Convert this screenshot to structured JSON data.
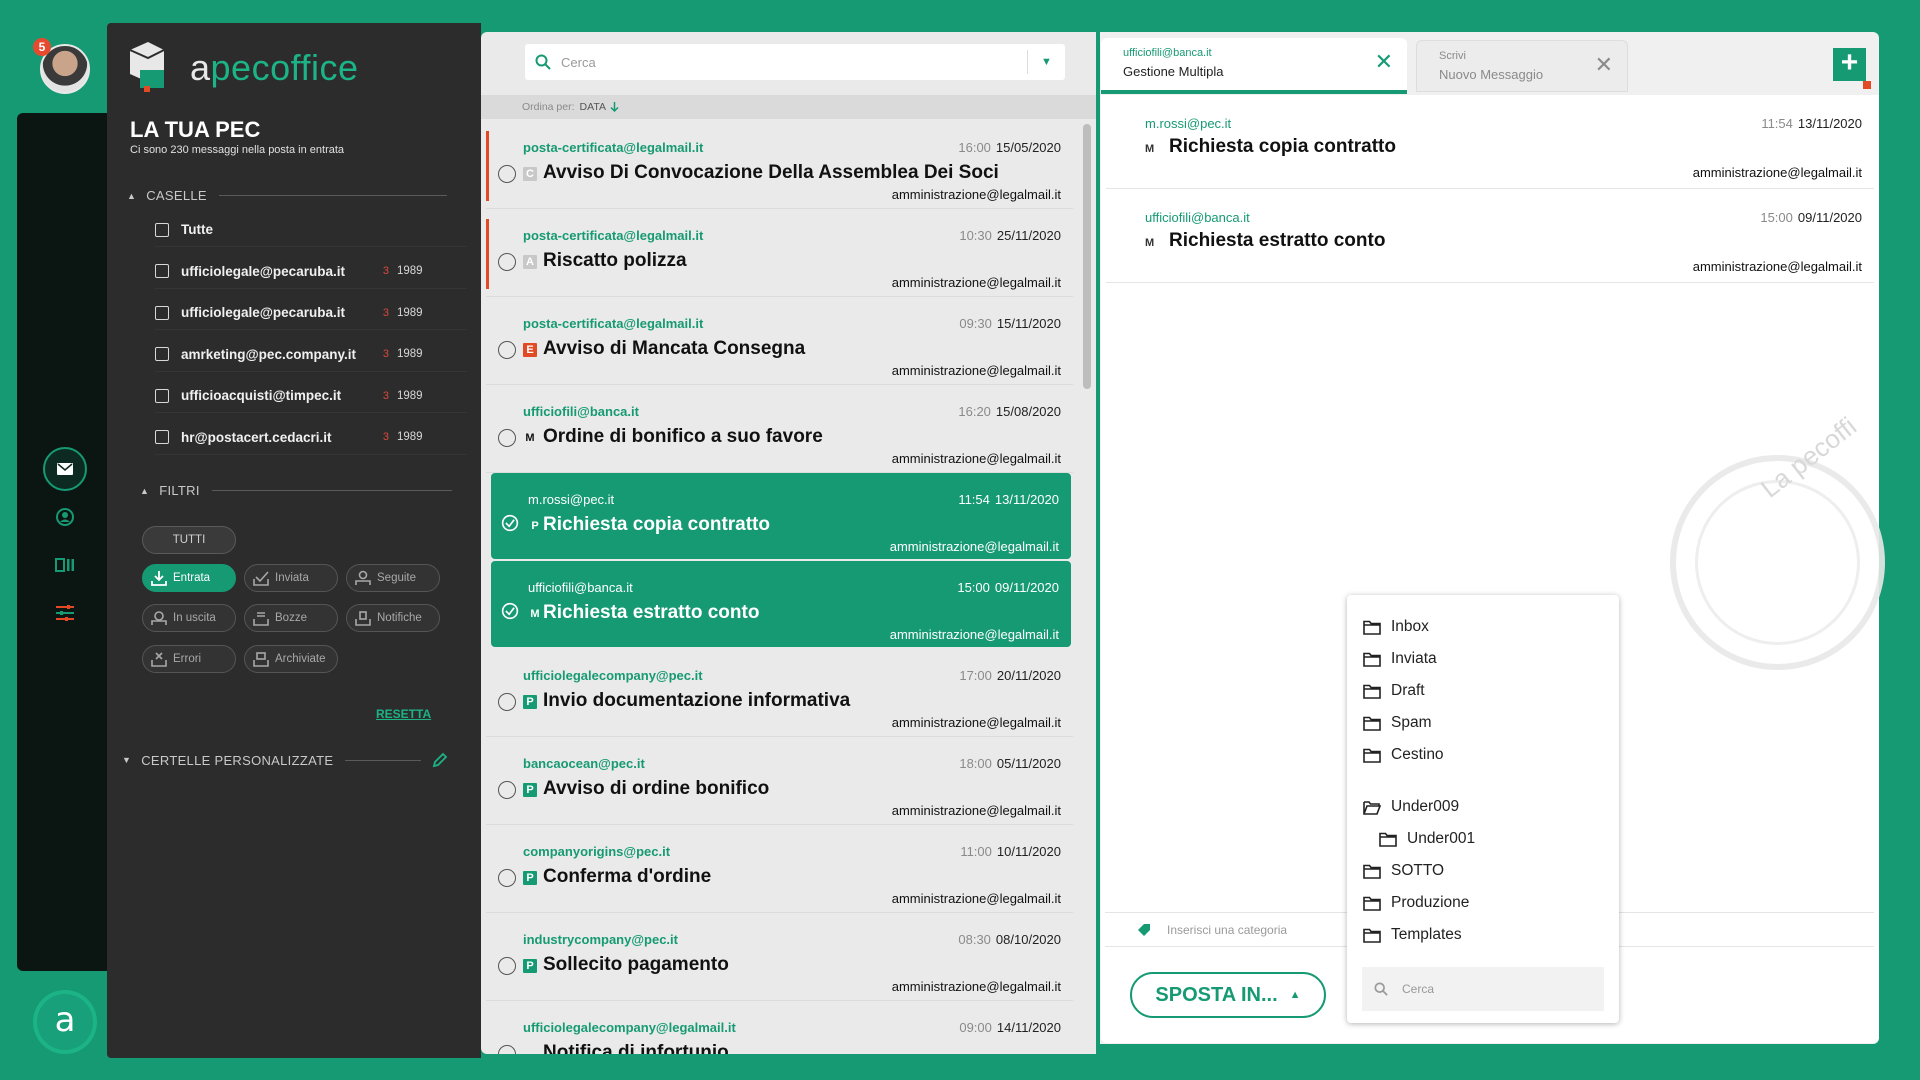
{
  "rail": {
    "avatar_badge": "5",
    "brand_glyph": "a",
    "accent": "#169a73",
    "icons": [
      "mail-icon",
      "user-icon",
      "cards-icon",
      "sliders-icon"
    ]
  },
  "sidebar": {
    "logo_a": "a",
    "logo_pec": "pecoffice",
    "title": "LA TUA PEC",
    "subtitle": "Ci sono 230 messaggi nella posta in entrata",
    "caselle_header": "CASELLE",
    "boxes": [
      {
        "label": "Tutte",
        "count": "",
        "total": ""
      },
      {
        "label": "ufficiolegale@pecaruba.it",
        "count": "3",
        "total": "1989"
      },
      {
        "label": "ufficiolegale@pecaruba.it",
        "count": "3",
        "total": "1989"
      },
      {
        "label": "amrketing@pec.company.it",
        "count": "3",
        "total": "1989"
      },
      {
        "label": "ufficioacquisti@timpec.it",
        "count": "3",
        "total": "1989"
      },
      {
        "label": "hr@postacert.cedacri.it",
        "count": "3",
        "total": "1989"
      }
    ],
    "filtri_header": "FILTRI",
    "filters": {
      "all": "TUTTI",
      "entrata": "Entrata",
      "inviata": "Inviata",
      "seguite": "Seguite",
      "in_uscita": "In uscita",
      "bozze": "Bozze",
      "notifiche": "Notifiche",
      "errori": "Errori",
      "archiviate": "Archiviate"
    },
    "reset": "RESETTA",
    "custom_header": "CERTELLE PERSONALIZZATE"
  },
  "list": {
    "search_placeholder": "Cerca",
    "sort_label": "Ordina per:",
    "sort_value": "DATA",
    "messages": [
      {
        "sender": "posta-certificata@legalmail.it",
        "time": "16:00",
        "date": "15/05/2020",
        "tag": "C",
        "subject": "Avviso Di Convocazione Della Assemblea Dei Soci",
        "recipient": "amministrazione@legalmail.it"
      },
      {
        "sender": "posta-certificata@legalmail.it",
        "time": "10:30",
        "date": "25/11/2020",
        "tag": "A",
        "subject": "Riscatto polizza",
        "recipient": "amministrazione@legalmail.it"
      },
      {
        "sender": "posta-certificata@legalmail.it",
        "time": "09:30",
        "date": "15/11/2020",
        "tag": "E",
        "subject": "Avviso di Mancata Consegna",
        "recipient": "amministrazione@legalmail.it"
      },
      {
        "sender": "ufficiofili@banca.it",
        "time": "16:20",
        "date": "15/08/2020",
        "tag": "M",
        "subject": "Ordine di bonifico a suo favore",
        "recipient": "amministrazione@legalmail.it"
      },
      {
        "sender": "m.rossi@pec.it",
        "time": "11:54",
        "date": "13/11/2020",
        "tag": "P",
        "subject": "Richiesta copia contratto",
        "recipient": "amministrazione@legalmail.it"
      },
      {
        "sender": "ufficiofili@banca.it",
        "time": "15:00",
        "date": "09/11/2020",
        "tag": "M",
        "subject": "Richiesta estratto conto",
        "recipient": "amministrazione@legalmail.it"
      },
      {
        "sender": "ufficiolegalecompany@pec.it",
        "time": "17:00",
        "date": "20/11/2020",
        "tag": "P",
        "subject": "Invio documentazione informativa",
        "recipient": "amministrazione@legalmail.it"
      },
      {
        "sender": "bancaocean@pec.it",
        "time": "18:00",
        "date": "05/11/2020",
        "tag": "P",
        "subject": "Avviso di ordine bonifico",
        "recipient": "amministrazione@legalmail.it"
      },
      {
        "sender": "companyorigins@pec.it",
        "time": "11:00",
        "date": "10/11/2020",
        "tag": "P",
        "subject": "Conferma d'ordine",
        "recipient": "amministrazione@legalmail.it"
      },
      {
        "sender": "industrycompany@pec.it",
        "time": "08:30",
        "date": "08/10/2020",
        "tag": "P",
        "subject": "Sollecito pagamento",
        "recipient": "amministrazione@legalmail.it"
      },
      {
        "sender": "ufficiolegalecompany@legalmail.it",
        "time": "09:00",
        "date": "14/11/2020",
        "tag": "",
        "subject": "Notifica di infortunio",
        "recipient": ""
      }
    ]
  },
  "tabs": [
    {
      "account": "ufficiofili@banca.it",
      "title": "Gestione Multipla"
    },
    {
      "account": "Scrivi",
      "title": "Nuovo Messaggio"
    }
  ],
  "detail": {
    "messages": [
      {
        "sender": "m.rossi@pec.it",
        "time": "11:54",
        "date": "13/11/2020",
        "tag": "M",
        "subject": "Richiesta copia contratto",
        "recipient": "amministrazione@legalmail.it"
      },
      {
        "sender": "ufficiofili@banca.it",
        "time": "15:00",
        "date": "09/11/2020",
        "tag": "M",
        "subject": "Richiesta estratto conto",
        "recipient": "amministrazione@legalmail.it"
      }
    ],
    "watermark": "La pecoffi",
    "category_placeholder": "Inserisci una categoria",
    "move_button": "SPOSTA IN..."
  },
  "folders": {
    "items": [
      {
        "label": "Inbox",
        "level": 0
      },
      {
        "label": "Inviata",
        "level": 0
      },
      {
        "label": "Draft",
        "level": 0
      },
      {
        "label": "Spam",
        "level": 0
      },
      {
        "label": "Cestino",
        "level": 0
      },
      {
        "label": "Under009",
        "level": 0
      },
      {
        "label": "Under001",
        "level": 1
      },
      {
        "label": "SOTTO",
        "level": 0
      },
      {
        "label": "Produzione",
        "level": 0
      },
      {
        "label": "Templates",
        "level": 0
      }
    ],
    "search_placeholder": "Cerca"
  }
}
